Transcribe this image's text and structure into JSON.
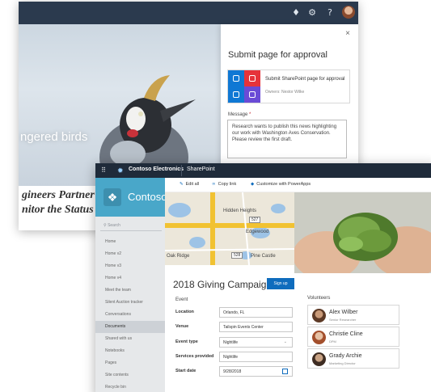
{
  "back_window": {
    "hero_text": "ngered birds",
    "article_lines": [
      "gineers Partner",
      "nitor the Status"
    ],
    "panel": {
      "title": "Submit page for approval",
      "close_glyph": "×",
      "flow_title": "Submit SharePoint page for approval",
      "flow_owner": "Owners: Nestor Wilke",
      "message_label": "Message",
      "message_required": "*",
      "message_text": "Research wants to publish this news highlighting our work with Washington Aves Conservation. Please review the first draft."
    }
  },
  "front_window": {
    "suite": {
      "waffle_glyph": "⠿",
      "brand": "Contoso Electronics",
      "app": "SharePoint"
    },
    "site_name": "Contoso E",
    "search_placeholder": "Search",
    "nav_items": [
      "Home",
      "Home v2",
      "Home v3",
      "Home v4",
      "Meet the team",
      "Silent Auction tracker",
      "Conversations",
      "Documents",
      "Shared with us",
      "Notebooks",
      "Pages",
      "Site contents",
      "Recycle bin"
    ],
    "active_nav_index": 7,
    "commands": {
      "edit_all": "Edit all",
      "copy_link": "Copy link",
      "customize": "Customize with PowerApps"
    },
    "map_labels": {
      "hidden_heights": "Hidden Heights",
      "edgewood": "Edgewood",
      "oak_ridge": "Oak Ridge",
      "pine_castle": "Pine Castle",
      "route_527": "527",
      "route_528": "528"
    },
    "campaign_title": "2018 Giving Campaign",
    "signup_label": "Sign up",
    "event_heading": "Event",
    "form": {
      "location_label": "Location",
      "location_value": "Orlando, FL",
      "venue_label": "Venue",
      "venue_value": "Tailspin Events Center",
      "event_type_label": "Event type",
      "event_type_value": "Nightlife",
      "services_label": "Services provided",
      "services_value": "Nightlife",
      "start_date_label": "Start date",
      "start_date_value": "9/28/2018"
    },
    "volunteers_heading": "Volunteers",
    "volunteers": [
      {
        "name": "Alex Wilber",
        "role": "Senior Researcher"
      },
      {
        "name": "Christie Cline",
        "role": "DPM"
      },
      {
        "name": "Grady Archie",
        "role": "Marketing Director"
      }
    ]
  },
  "colors": {
    "suite_bar": "#1f2b3a",
    "back_topbar": "#2b3a4e",
    "site_header": "#49a7c9",
    "accent": "#0f6cbd"
  }
}
